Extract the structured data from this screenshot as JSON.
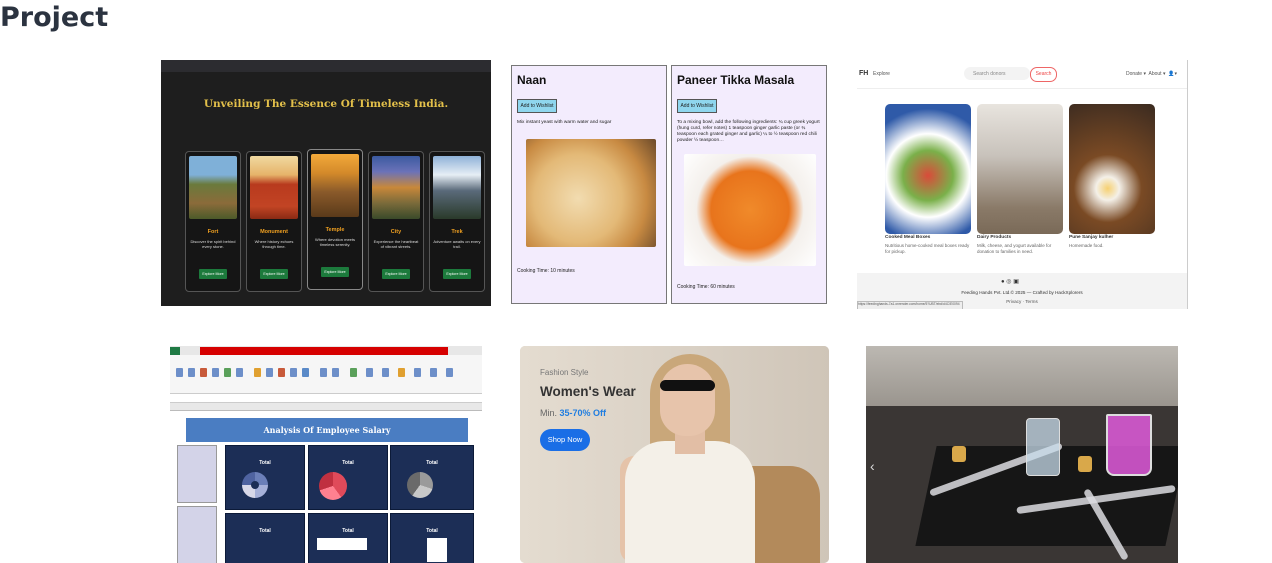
{
  "page": {
    "title": "Project"
  },
  "projects": [
    {
      "heading": "Unveiling The Essence Of Timeless India.",
      "cards": [
        {
          "title": "Fort",
          "desc": "Discover the spirit behind every stone.",
          "button": "Explore More"
        },
        {
          "title": "Monument",
          "desc": "Where history echoes through time.",
          "button": "Explore More"
        },
        {
          "title": "Temple",
          "desc": "Where devotion meets timeless serenity.",
          "button": "Explore More"
        },
        {
          "title": "City",
          "desc": "Experience the heartbeat of vibrant streets.",
          "button": "Explore More"
        },
        {
          "title": "Trek",
          "desc": "Adventure awaits on every trail.",
          "button": "Explore More"
        }
      ]
    },
    {
      "recipes": [
        {
          "name": "Naan",
          "button": "Add to Wishlist",
          "desc": "Mix instant yeast with warm water and sugar",
          "time": "Cooking Time: 10 minutes"
        },
        {
          "name": "Paneer Tikka Masala",
          "button": "Add to Wishlist",
          "desc": "To a mixing bowl, add the following ingredients: ¾ cup greek yogurt (hung curd, refer notes) 1 teaspoon ginger garlic paste (or ¾ teaspoon each grated ginger and garlic) ¼ to ½ teaspoon red chili powder ½ teaspoon…",
          "time": "Cooking Time: 60 minutes"
        }
      ]
    },
    {
      "nav": {
        "logo": "FH",
        "explore": "Explore",
        "search_placeholder": "Search donors",
        "search_button": "Search",
        "donate": "Donate ▾",
        "about": "About ▾",
        "user": "👤▾"
      },
      "products": [
        {
          "title": "Cooked Meal Boxes",
          "desc": "Nutritious home-cooked meal boxes ready for pickup."
        },
        {
          "title": "Dairy Products",
          "desc": "Milk, cheese, and yogurt available for donation to families in need."
        },
        {
          "title": "Pune Sanjay kulher",
          "desc": "Homemade food."
        }
      ],
      "footer": {
        "copyright": "Feeding Hands Pvt. Ltd.© 2025 — Crafted by HackXplorers",
        "links": "Privacy · Terms",
        "status_url": "https://feedinghands-7a1.onrender.com/home/5?UBT/ebd/d4C/E0094"
      }
    },
    {
      "banner": "Analysis Of Employee Salary",
      "pivot_title": "Total",
      "status_color": "#d60000"
    },
    {
      "subtitle": "Fashion Style",
      "heading": "Women's Wear",
      "discount_prefix": "Min.",
      "discount_value": "35-70% Off",
      "button": "Shop Now"
    },
    {
      "prev_icon": "‹"
    }
  ]
}
